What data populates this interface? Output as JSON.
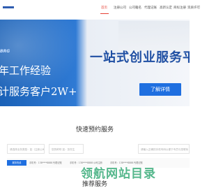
{
  "header": {
    "logo_text": "",
    "nav": [
      "首页",
      "注册公司",
      "公司籍名",
      "代理记账",
      "高新认定",
      "商标注册",
      "资质许可"
    ]
  },
  "banner": {
    "tag_text": "BRG",
    "line1": "年工作经验",
    "line2": "计服务客户2W+",
    "title": "一站式创业服务平",
    "cta_label": "了解详情"
  },
  "booking": {
    "title": "快速预约服务",
    "inputs": [
      "请选择业务类型：如（注册公司",
      "您的称呼 如：张先生",
      "请输入正确的手机号码以便于专员与您联系"
    ],
    "badge": "服务热线",
    "info": [
      "手机号：138****8888",
      "代理记账",
      "手机号：138****8888",
      "公司注册",
      "手机号：138****8888",
      "代理记账"
    ]
  },
  "watermark": "领航网站目录",
  "section2_title": "推荐服务",
  "colors": {
    "accent": "#e64035",
    "primary": "#1f6fe0",
    "banner_blue": "#1a61b7"
  }
}
